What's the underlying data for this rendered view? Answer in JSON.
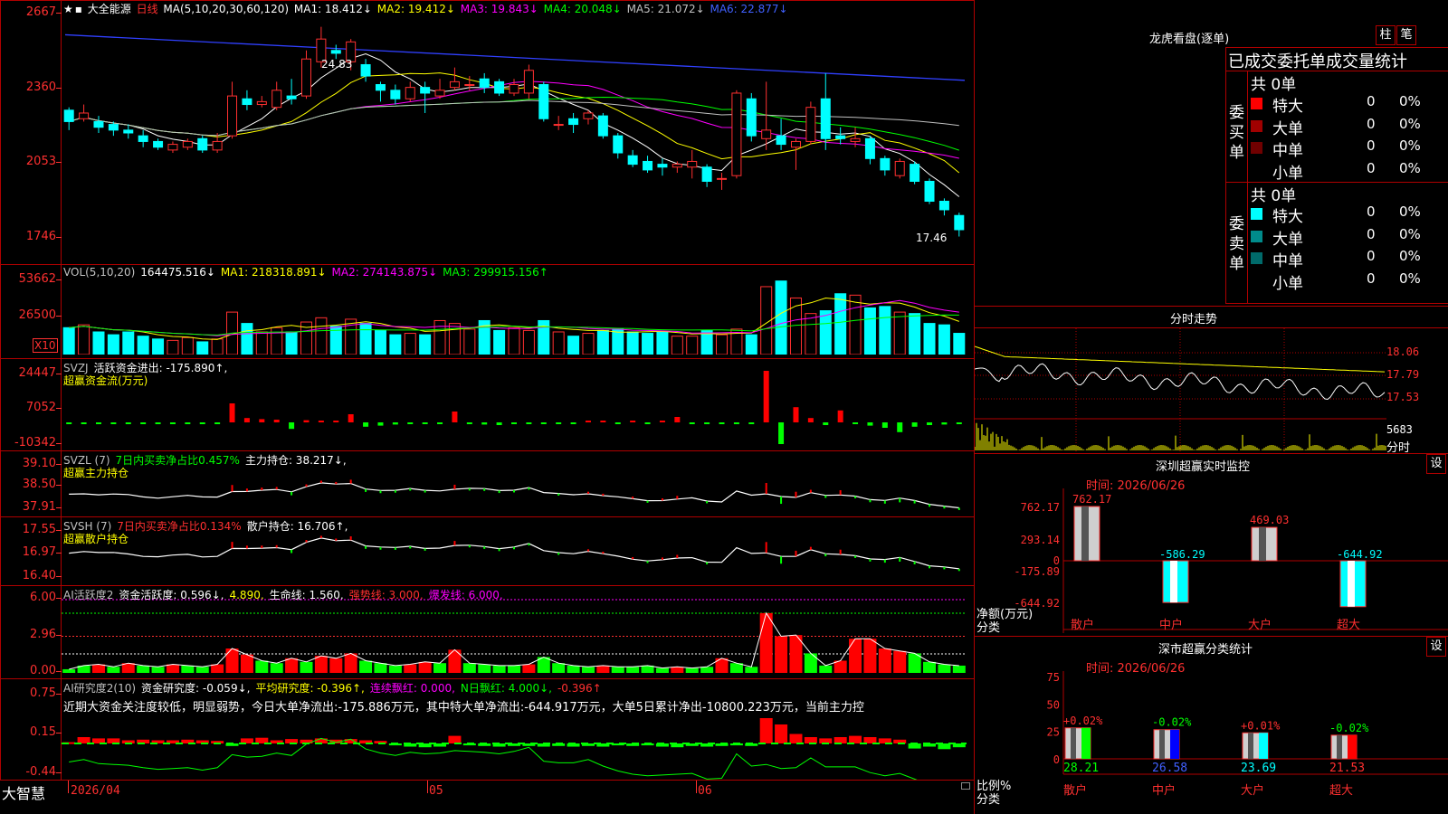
{
  "main": {
    "title": "大全能源",
    "period": "日线",
    "ma_header": "MA(5,10,20,30,60,120)",
    "ma": [
      {
        "label": "MA1: 18.412↓",
        "color": "#ffffff"
      },
      {
        "label": "MA2: 19.412↓",
        "color": "#ffff00"
      },
      {
        "label": "MA3: 19.843↓",
        "color": "#ff00ff"
      },
      {
        "label": "MA4: 20.048↓",
        "color": "#00ff00"
      },
      {
        "label": "MA5: 21.072↓",
        "color": "#c0c0c0"
      },
      {
        "label": "MA6: 22.877↓",
        "color": "#4060ff"
      }
    ],
    "yticks": [
      "2667",
      "2360",
      "2053",
      "1746"
    ],
    "high_label": "24.83",
    "low_label": "17.46",
    "candles": [
      [
        21.9,
        21.5,
        22.0,
        21.2
      ],
      [
        21.6,
        21.8,
        22.1,
        21.5
      ],
      [
        21.5,
        21.3,
        21.7,
        21.1
      ],
      [
        21.4,
        21.2,
        21.5,
        21.0
      ],
      [
        21.2,
        21.1,
        21.4,
        20.9
      ],
      [
        21.0,
        20.8,
        21.2,
        20.6
      ],
      [
        20.8,
        20.6,
        20.9,
        20.5
      ],
      [
        20.5,
        20.7,
        20.8,
        20.4
      ],
      [
        20.6,
        20.8,
        20.9,
        20.5
      ],
      [
        20.9,
        20.5,
        21.0,
        20.4
      ],
      [
        20.5,
        20.8,
        21.1,
        20.4
      ],
      [
        21.0,
        22.4,
        22.9,
        20.9
      ],
      [
        22.3,
        22.1,
        22.6,
        21.9
      ],
      [
        22.1,
        22.2,
        22.4,
        22.0
      ],
      [
        22.0,
        22.6,
        22.9,
        21.9
      ],
      [
        22.4,
        22.3,
        23.0,
        22.1
      ],
      [
        22.4,
        23.7,
        24.0,
        22.3
      ],
      [
        23.6,
        24.4,
        24.83,
        23.4
      ],
      [
        24.0,
        23.9,
        24.2,
        23.7
      ],
      [
        23.6,
        24.3,
        24.4,
        23.3
      ],
      [
        23.5,
        23.1,
        23.7,
        22.9
      ],
      [
        22.8,
        22.6,
        22.9,
        22.2
      ],
      [
        22.6,
        22.3,
        22.8,
        22.1
      ],
      [
        22.3,
        22.7,
        22.9,
        22.2
      ],
      [
        22.7,
        22.5,
        22.9,
        21.8
      ],
      [
        22.4,
        22.6,
        23.0,
        22.3
      ],
      [
        22.7,
        22.9,
        23.4,
        22.6
      ],
      [
        22.8,
        22.8,
        23.1,
        22.6
      ],
      [
        23.0,
        22.7,
        23.2,
        22.5
      ],
      [
        22.9,
        22.5,
        23.0,
        22.4
      ],
      [
        22.5,
        22.8,
        23.0,
        22.4
      ],
      [
        22.5,
        23.3,
        23.5,
        22.3
      ],
      [
        22.8,
        21.6,
        22.9,
        21.5
      ],
      [
        21.4,
        21.4,
        21.7,
        21.2
      ],
      [
        21.6,
        21.4,
        21.8,
        21.1
      ],
      [
        21.6,
        21.8,
        21.9,
        21.4
      ],
      [
        21.7,
        21.0,
        21.8,
        20.9
      ],
      [
        21.0,
        20.4,
        21.1,
        20.2
      ],
      [
        20.3,
        20.0,
        20.5,
        19.9
      ],
      [
        20.1,
        19.8,
        20.3,
        19.7
      ],
      [
        20.0,
        19.9,
        20.2,
        19.6
      ],
      [
        19.9,
        20.0,
        20.1,
        19.7
      ],
      [
        19.9,
        20.1,
        20.5,
        19.5
      ],
      [
        19.9,
        19.4,
        20.0,
        19.2
      ],
      [
        19.5,
        19.5,
        19.7,
        19.1
      ],
      [
        19.6,
        22.5,
        22.6,
        19.5
      ],
      [
        22.3,
        21.0,
        22.5,
        20.8
      ],
      [
        20.9,
        21.2,
        22.9,
        20.5
      ],
      [
        21.0,
        20.7,
        21.6,
        20.5
      ],
      [
        20.6,
        20.8,
        20.9,
        19.8
      ],
      [
        20.8,
        22.0,
        22.2,
        20.7
      ],
      [
        22.3,
        20.9,
        23.2,
        20.5
      ],
      [
        21.0,
        20.9,
        21.3,
        20.7
      ],
      [
        20.8,
        20.9,
        21.3,
        20.6
      ],
      [
        20.9,
        20.2,
        21.0,
        20.0
      ],
      [
        20.2,
        19.8,
        20.3,
        19.6
      ],
      [
        19.6,
        20.1,
        20.2,
        19.5
      ],
      [
        20.0,
        19.4,
        20.1,
        19.3
      ],
      [
        19.4,
        18.7,
        19.5,
        18.6
      ],
      [
        18.7,
        18.4,
        18.8,
        18.2
      ],
      [
        18.2,
        17.7,
        18.3,
        17.46
      ]
    ]
  },
  "vol": {
    "header": [
      {
        "label": "VOL(5,10,20)",
        "color": "#c0c0c0"
      },
      {
        "label": "164475.516↓",
        "color": "#ffffff"
      },
      {
        "label": "MA1: 218318.891↓",
        "color": "#ffff00"
      },
      {
        "label": "MA2: 274143.875↓",
        "color": "#ff00ff"
      },
      {
        "label": "MA3: 299915.156↑",
        "color": "#00ff00"
      }
    ],
    "yticks": [
      "53662",
      "26500"
    ],
    "unit": "X10",
    "values": [
      19,
      21,
      16,
      14,
      16,
      13,
      11,
      10,
      12,
      9,
      11,
      30,
      22,
      16,
      19,
      16,
      23,
      26,
      20,
      25,
      22,
      17,
      14,
      15,
      14,
      24,
      22,
      18,
      24,
      17,
      19,
      17,
      24,
      16,
      13,
      15,
      17,
      18,
      16,
      15,
      16,
      13,
      13,
      17,
      14,
      18,
      14,
      48,
      52,
      40,
      29,
      31,
      43,
      42,
      33,
      34,
      30,
      29,
      22,
      21,
      15
    ]
  },
  "svzj": {
    "header": [
      {
        "label": "SVZJ",
        "color": "#c0c0c0"
      },
      {
        "label": "活跃资金进出: -175.890↑,",
        "color": "#ffffff"
      }
    ],
    "sub": "超赢资金流(万元)",
    "yticks": [
      "24447",
      "7052",
      "-10342"
    ],
    "values": [
      0,
      0,
      0,
      0,
      0,
      0,
      0,
      0,
      0,
      0,
      0,
      35,
      8,
      6,
      5,
      -12,
      4,
      3,
      2,
      15,
      -8,
      -6,
      -4,
      -3,
      -3,
      0,
      20,
      -3,
      -4,
      -5,
      -3,
      -2,
      0,
      -3,
      0,
      2,
      1,
      0,
      2,
      -2,
      3,
      10,
      0,
      -3,
      0,
      0,
      0,
      95,
      -40,
      28,
      8,
      -5,
      22,
      -3,
      -6,
      -10,
      -18,
      -8,
      -5,
      -4,
      -3
    ]
  },
  "svzl": {
    "header": [
      {
        "label": "SVZL (7)",
        "color": "#c0c0c0"
      },
      {
        "label": "7日内买卖净占比0.457%",
        "color": "#00ff00"
      },
      {
        "label": "主力持仓: 38.217↓,",
        "color": "#ffffff"
      }
    ],
    "sub": "超赢主力持仓",
    "yticks": [
      "39.10",
      "38.50",
      "37.91"
    ]
  },
  "svsh": {
    "header": [
      {
        "label": "SVSH (7)",
        "color": "#c0c0c0"
      },
      {
        "label": "7日内买卖净占比0.134%",
        "color": "#ff3030"
      },
      {
        "label": "散户持仓: 16.706↑,",
        "color": "#ffffff"
      }
    ],
    "sub": "超赢散户持仓",
    "yticks": [
      "17.55",
      "16.97",
      "16.40"
    ]
  },
  "ai1": {
    "header": [
      {
        "label": "AI活跃度2",
        "color": "#c0c0c0"
      },
      {
        "label": "资金活跃度: 0.596↓,",
        "color": "#ffffff"
      },
      {
        "label": "4.890,",
        "color": "#ffff00"
      },
      {
        "label": "生命线: 1.560,",
        "color": "#ffffff"
      },
      {
        "label": "强势线: 3.000,",
        "color": "#ff3030"
      },
      {
        "label": "爆发线: 6.000,",
        "color": "#ff00ff"
      }
    ],
    "yticks": [
      "6.00",
      "2.96",
      "0.00"
    ],
    "values": [
      0.3,
      0.6,
      0.7,
      0.5,
      0.8,
      0.6,
      0.5,
      0.7,
      0.6,
      0.5,
      0.7,
      2.0,
      1.5,
      1.0,
      0.8,
      1.2,
      0.9,
      1.4,
      1.2,
      1.6,
      1.0,
      0.8,
      0.6,
      0.7,
      0.9,
      0.8,
      1.9,
      0.8,
      0.7,
      0.6,
      0.6,
      0.7,
      1.3,
      0.8,
      0.6,
      0.5,
      0.6,
      0.5,
      0.5,
      0.6,
      0.4,
      0.5,
      0.4,
      0.5,
      1.2,
      0.8,
      0.5,
      4.9,
      3.0,
      3.1,
      1.6,
      0.6,
      1.0,
      2.8,
      2.8,
      2.0,
      1.8,
      1.6,
      0.9,
      0.7,
      0.596
    ],
    "up": [
      0,
      0,
      1,
      0,
      1,
      0,
      0,
      1,
      0,
      0,
      1,
      1,
      1,
      0,
      0,
      1,
      0,
      1,
      1,
      1,
      0,
      0,
      0,
      1,
      1,
      0,
      1,
      0,
      0,
      0,
      0,
      1,
      0,
      0,
      0,
      0,
      1,
      0,
      0,
      0,
      0,
      1,
      0,
      0,
      1,
      0,
      0,
      1,
      1,
      1,
      0,
      0,
      1,
      1,
      1,
      1,
      1,
      0,
      0,
      0,
      0
    ]
  },
  "ai2": {
    "header": [
      {
        "label": "AI研究度2(10)",
        "color": "#c0c0c0"
      },
      {
        "label": "资金研究度: -0.059↓,",
        "color": "#ffffff"
      },
      {
        "label": "平均研究度: -0.396↑,",
        "color": "#ffff00"
      },
      {
        "label": "连续飘红: 0.000,",
        "color": "#ff00ff"
      },
      {
        "label": "N日飘红: 4.000↓,",
        "color": "#00ff00"
      },
      {
        "label": "-0.396↑",
        "color": "#ff3030"
      }
    ],
    "comment": "近期大资金关注度较低，明显弱势，今日大单净流出:-175.886万元，其中特大单净流出:-644.917万元，大单5日累计净出-10800.223万元，当前主力控",
    "yticks": [
      "0.75",
      "0.15",
      "-0.44"
    ],
    "values": [
      0.02,
      0.1,
      0.08,
      0.08,
      0.05,
      0.06,
      0.05,
      0.05,
      0.06,
      0.05,
      0.04,
      -0.04,
      0.08,
      0.09,
      0.05,
      0.07,
      0.06,
      0.08,
      0.06,
      0.07,
      0.05,
      0.04,
      -0.03,
      -0.05,
      -0.06,
      -0.05,
      0.12,
      -0.03,
      -0.04,
      -0.05,
      -0.04,
      -0.04,
      -0.05,
      -0.04,
      -0.05,
      -0.04,
      -0.05,
      -0.03,
      -0.04,
      -0.03,
      -0.05,
      -0.06,
      -0.04,
      -0.05,
      -0.04,
      -0.03,
      -0.04,
      0.4,
      0.3,
      0.15,
      0.1,
      0.08,
      0.1,
      0.12,
      0.1,
      0.08,
      0.06,
      -0.08,
      -0.05,
      -0.09,
      -0.06
    ]
  },
  "bottom": {
    "brand": "大智慧",
    "date_first": "2026/04",
    "month2": "05",
    "month3": "06"
  },
  "longhu": {
    "title": "龙虎看盘(逐单)",
    "btn1": "柱",
    "btn2": "笔",
    "subtitle": "已成交委托单成交量统计",
    "buy_total": "共 0单",
    "buy_label": [
      "委",
      "买",
      "单"
    ],
    "sell_total": "共 0单",
    "sell_label": [
      "委",
      "卖",
      "单"
    ],
    "buy_rows": [
      {
        "name": "特大",
        "count": "0",
        "pct": "0%",
        "color": "#ff0000"
      },
      {
        "name": "大单",
        "count": "0",
        "pct": "0%",
        "color": "#a00000"
      },
      {
        "name": "中单",
        "count": "0",
        "pct": "0%",
        "color": "#700000"
      },
      {
        "name": "小单",
        "count": "0",
        "pct": "0%",
        "color": "#000000"
      }
    ],
    "sell_rows": [
      {
        "name": "特大",
        "count": "0",
        "pct": "0%",
        "color": "#00ffff"
      },
      {
        "name": "大单",
        "count": "0",
        "pct": "0%",
        "color": "#008b8b"
      },
      {
        "name": "中单",
        "count": "0",
        "pct": "0%",
        "color": "#006a6a"
      },
      {
        "name": "小单",
        "count": "0",
        "pct": "0%",
        "color": "#000000"
      }
    ]
  },
  "fenshi": {
    "title": "分时走势",
    "yticks": [
      "18.06",
      "17.79",
      "17.53"
    ],
    "vol_tick": "5683",
    "vol_label": "分时"
  },
  "monitor": {
    "title": "深圳超赢实时监控",
    "settings": "设",
    "time": "时间: 2026/06/26",
    "yticks": [
      "762.17",
      "293.14",
      "0",
      "-175.89",
      "-644.92"
    ],
    "ylabel1": "净额(万元)",
    "ylabel2": "分类",
    "bars": [
      {
        "cat": "散户",
        "value": 762.17,
        "label": "762.17"
      },
      {
        "cat": "中户",
        "value": -586.29,
        "label": "-586.29"
      },
      {
        "cat": "大户",
        "value": 469.03,
        "label": "469.03"
      },
      {
        "cat": "超大",
        "value": -644.92,
        "label": "-644.92"
      }
    ]
  },
  "classify": {
    "title": "深市超赢分类统计",
    "settings": "设",
    "time": "时间: 2026/06/26",
    "yticks": [
      "75",
      "50",
      "25",
      "0"
    ],
    "ylabel1": "比例%",
    "ylabel2": "分类",
    "bars": [
      {
        "cat": "散户",
        "value": 28.21,
        "label": "28.21",
        "change": "+0.02%",
        "color": "#00ff00"
      },
      {
        "cat": "中户",
        "value": 26.58,
        "label": "26.58",
        "change": "-0.02%",
        "color": "#0000ff"
      },
      {
        "cat": "大户",
        "value": 23.69,
        "label": "23.69",
        "change": "+0.01%",
        "color": "#00ffff"
      },
      {
        "cat": "超大",
        "value": 21.53,
        "label": "21.53",
        "change": "-0.02%",
        "color": "#ff0000"
      }
    ]
  }
}
